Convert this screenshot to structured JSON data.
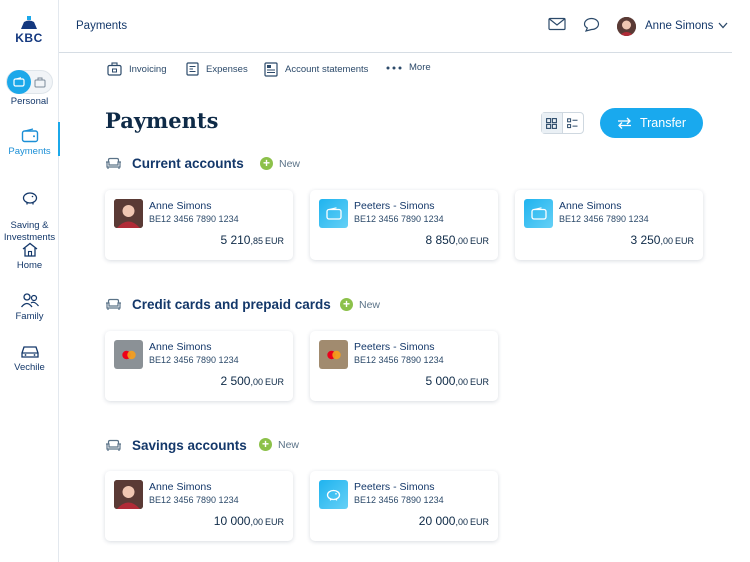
{
  "brand": {
    "name": "KBC"
  },
  "sidebar": {
    "profile_label": "Personal",
    "items": [
      {
        "label": "Payments"
      },
      {
        "label": "Saving &\nInvestments"
      },
      {
        "label": "Home"
      },
      {
        "label": "Family"
      },
      {
        "label": "Vechile"
      }
    ]
  },
  "header": {
    "title": "Payments",
    "user_name": "Anne Simons"
  },
  "tabs": [
    {
      "label": "Invoicing",
      "icon": "briefcase-icon"
    },
    {
      "label": "Expenses",
      "icon": "receipt-icon"
    },
    {
      "label": "Account statements",
      "icon": "statement-icon"
    },
    {
      "label": "More",
      "icon": "more-dots-icon"
    }
  ],
  "page": {
    "title": "Payments",
    "transfer_label": "Transfer"
  },
  "sections": [
    {
      "title": "Current accounts",
      "new_label": "New",
      "cards": [
        {
          "owner": "Anne Simons",
          "iban": "BE12 3456 7890 1234",
          "amount_int": "5 210",
          "amount_dec": ",85",
          "currency": "EUR",
          "thumb": "person"
        },
        {
          "owner": "Peeters - Simons",
          "iban": "BE12 3456 7890 1234",
          "amount_int": "8 850",
          "amount_dec": ",00",
          "currency": "EUR",
          "thumb": "wallet"
        },
        {
          "owner": "Anne Simons",
          "iban": "BE12 3456 7890 1234",
          "amount_int": "3 250",
          "amount_dec": ",00",
          "currency": "EUR",
          "thumb": "wallet"
        }
      ]
    },
    {
      "title": "Credit cards and prepaid cards",
      "new_label": "New",
      "cards": [
        {
          "owner": "Anne Simons",
          "iban": "BE12 3456 7890 1234",
          "amount_int": "2 500",
          "amount_dec": ",00",
          "currency": "EUR",
          "thumb": "mastercard-grey"
        },
        {
          "owner": "Peeters - Simons",
          "iban": "BE12 3456 7890 1234",
          "amount_int": "5 000",
          "amount_dec": ",00",
          "currency": "EUR",
          "thumb": "mastercard-brown"
        }
      ]
    },
    {
      "title": "Savings accounts",
      "new_label": "New",
      "cards": [
        {
          "owner": "Anne Simons",
          "iban": "BE12 3456 7890 1234",
          "amount_int": "10 000",
          "amount_dec": ",00",
          "currency": "EUR",
          "thumb": "person"
        },
        {
          "owner": "Peeters - Simons",
          "iban": "BE12 3456 7890 1234",
          "amount_int": "20 000",
          "amount_dec": ",00",
          "currency": "EUR",
          "thumb": "piggy"
        }
      ]
    }
  ],
  "colors": {
    "accent": "#19a9ee",
    "navy": "#0e2a47",
    "new_green": "#8cc14a"
  }
}
